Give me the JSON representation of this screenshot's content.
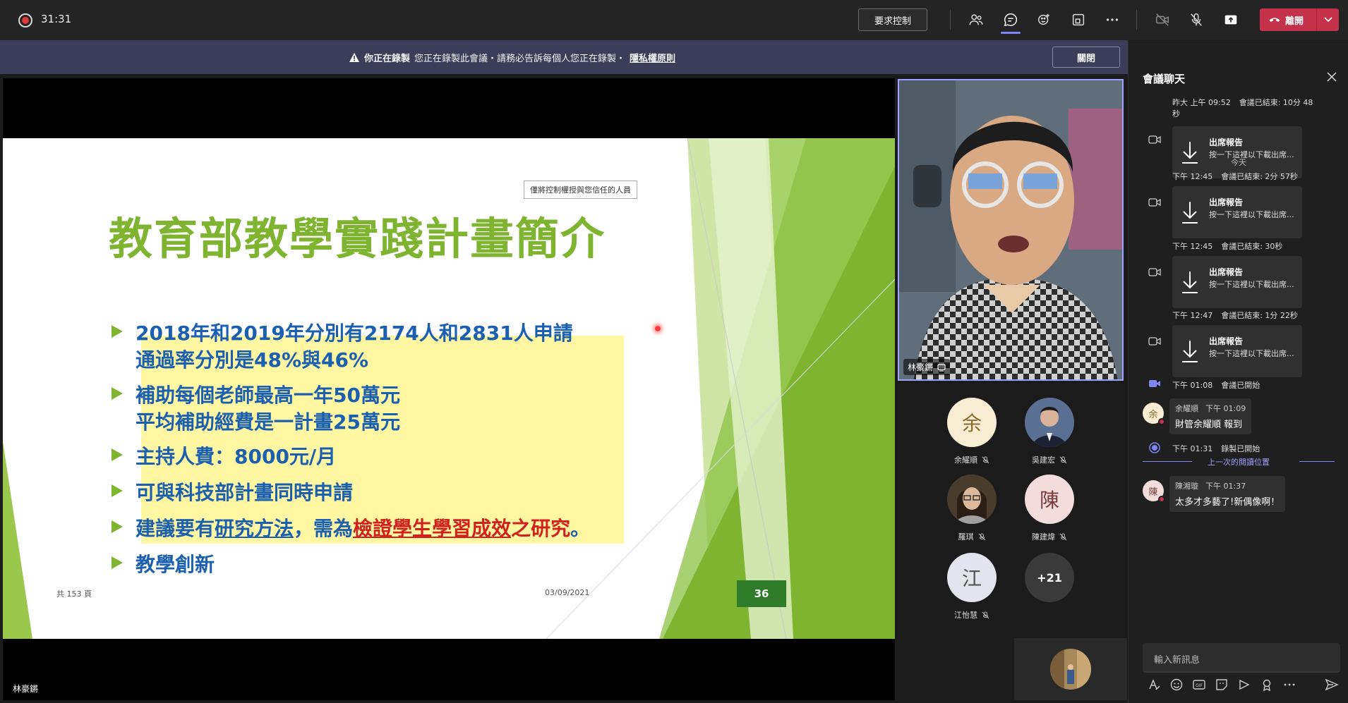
{
  "topbar": {
    "timer": "31:31",
    "request_control": "要求控制",
    "leave_label": "離開"
  },
  "banner": {
    "strong": "你正在錄製",
    "message": "您正在錄製此會議・請務必告訴每個人您正在錄製・",
    "link": "隱私權原則",
    "close": "關閉"
  },
  "slide": {
    "control_tip": "僅將控制權授與您信任的人員",
    "title": "教育部教學實踐計畫簡介",
    "bullets": [
      {
        "lines": [
          "2018年和2019年分別有2174人和2831人申請",
          "通過率分別是48%與46%"
        ]
      },
      {
        "lines": [
          "補助每個老師最高一年50萬元",
          "平均補助經費是一計畫25萬元"
        ]
      },
      {
        "lines": [
          "主持人費：8000元/月"
        ]
      },
      {
        "lines": [
          "可與科技部計畫同時申請"
        ]
      },
      {
        "parts": [
          "建議要有",
          "研究方法",
          "，需為",
          "檢證學生",
          "學習",
          "成效",
          "之研究",
          "。"
        ]
      },
      {
        "lines": [
          "教學創新"
        ]
      }
    ],
    "footer_left": "共 153 頁",
    "footer_date": "03/09/2021",
    "slide_number": "36",
    "accent_color": "#7fb431"
  },
  "presenter": {
    "name": "林豪鏘"
  },
  "participants": [
    {
      "name": "余耀順",
      "initial": "余"
    },
    {
      "name": "吳建宏",
      "initial": ""
    },
    {
      "name": "羅琪",
      "initial": ""
    },
    {
      "name": "陳建煒",
      "initial": "陳"
    },
    {
      "name": "江怡慧",
      "initial": "江"
    },
    {
      "name": "",
      "initial": "+21"
    }
  ],
  "chat": {
    "title": "會議聊天",
    "items": [
      {
        "time": "昨大 上午 09:52",
        "event": "會議已結束: 10分 48",
        "event2": "秒"
      },
      {
        "card_title": "出席報告",
        "card_sub": "按一下這裡以下載出席..."
      },
      {
        "day": "今天"
      },
      {
        "time": "下午 12:45",
        "event": "會議已結束: 2分 57秒"
      },
      {
        "card_title": "出席報告",
        "card_sub": "按一下這裡以下載出席..."
      },
      {
        "time": "下午 12:45",
        "event": "會議已結束: 30秒"
      },
      {
        "card_title": "出席報告",
        "card_sub": "按一下這裡以下載出席..."
      },
      {
        "time": "下午 12:47",
        "event": "會議已結束: 1分 22秒"
      },
      {
        "card_title": "出席報告",
        "card_sub": "按一下這裡以下載出席..."
      },
      {
        "time": "下午 01:08",
        "event": "會議已開始"
      },
      {
        "author": "余耀順",
        "author_initial": "余",
        "time": "下午 01:09",
        "text": "財管余耀順 報到"
      },
      {
        "time": "下午 01:31",
        "event": "錄製已開始"
      },
      {
        "last_read": "上一次的閱讀位置"
      },
      {
        "author": "陳湘璇",
        "author_initial": "陳",
        "time": "下午 01:37",
        "text": "太多才多藝了!新偶像啊！"
      }
    ],
    "compose_placeholder": "輸入新訊息"
  }
}
